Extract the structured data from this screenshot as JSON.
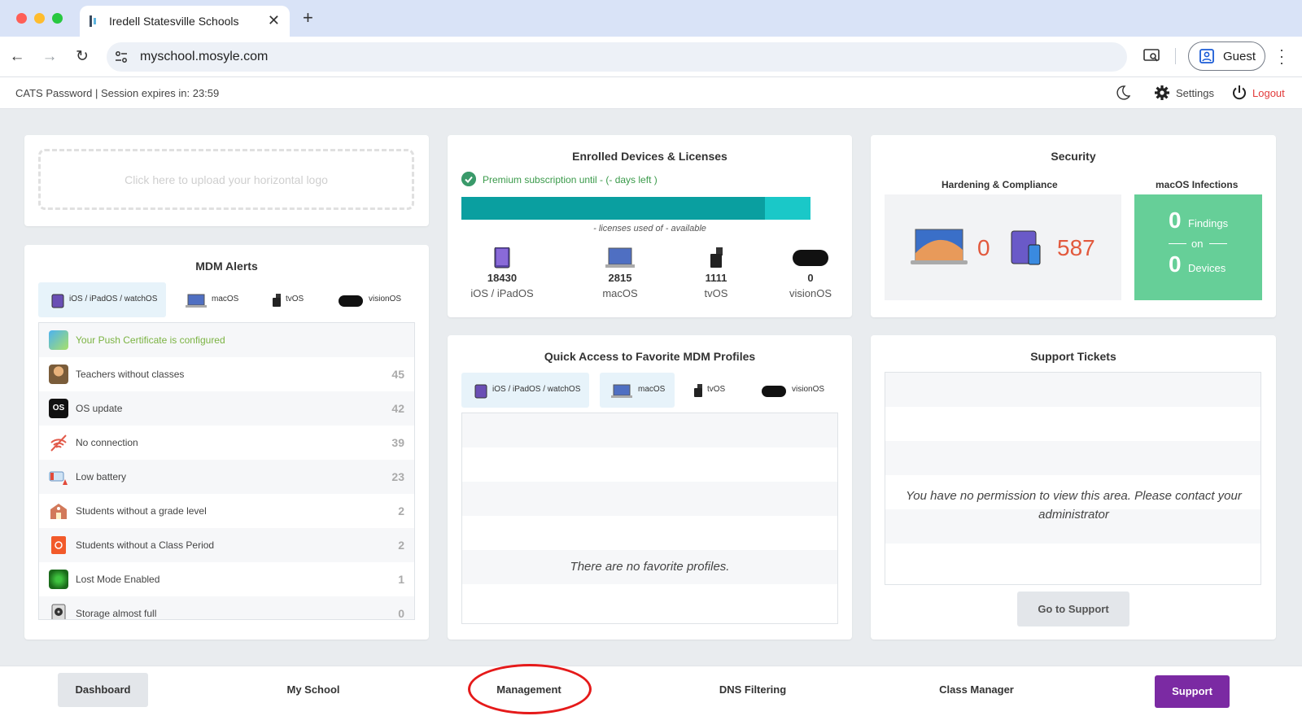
{
  "browser": {
    "tab_title": "Iredell Statesville Schools",
    "url": "myschool.mosyle.com",
    "profile_label": "Guest"
  },
  "header": {
    "session_text": "CATS Password | Session expires in: 23:59",
    "settings_label": "Settings",
    "logout_label": "Logout"
  },
  "logo_upload": {
    "text": "Click here to upload your horizontal logo"
  },
  "os_tabs": [
    {
      "label": "iOS / iPadOS / watchOS",
      "icon": "ipad-icon"
    },
    {
      "label": "macOS",
      "icon": "macbook-icon"
    },
    {
      "label": "tvOS",
      "icon": "apple-tv-icon"
    },
    {
      "label": "visionOS",
      "icon": "vision-pro-icon"
    }
  ],
  "mdm_alerts": {
    "title": "MDM Alerts",
    "items": [
      {
        "label": "Your Push Certificate is configured",
        "count": "",
        "icon": "push-certificate-icon"
      },
      {
        "label": "Teachers without classes",
        "count": "45",
        "icon": "teacher-icon"
      },
      {
        "label": "OS update",
        "count": "42",
        "icon": "os-update-icon"
      },
      {
        "label": "No connection",
        "count": "39",
        "icon": "no-connection-icon"
      },
      {
        "label": "Low battery",
        "count": "23",
        "icon": "low-battery-icon"
      },
      {
        "label": "Students without a grade level",
        "count": "2",
        "icon": "school-icon"
      },
      {
        "label": "Students without a Class Period",
        "count": "2",
        "icon": "class-period-icon"
      },
      {
        "label": "Lost Mode Enabled",
        "count": "1",
        "icon": "lost-mode-icon"
      },
      {
        "label": "Storage almost full",
        "count": "0",
        "icon": "storage-icon"
      }
    ]
  },
  "enrolled": {
    "title": "Enrolled Devices & Licenses",
    "premium_text": "Premium subscription until - (- days left )",
    "license_text": "- licenses used of - available",
    "license_used_fraction": 0.87,
    "devices": [
      {
        "count": "18430",
        "label": "iOS / iPadOS"
      },
      {
        "count": "2815",
        "label": "macOS"
      },
      {
        "count": "1111",
        "label": "tvOS"
      },
      {
        "count": "0",
        "label": "visionOS"
      }
    ]
  },
  "security": {
    "title": "Security",
    "hardening_title": "Hardening & Compliance",
    "infections_title": "macOS Infections",
    "mac_count": "0",
    "ios_count": "587",
    "findings_count": "0",
    "findings_label": "Findings",
    "on_label": "on",
    "devices_count": "0",
    "devices_label": "Devices"
  },
  "quick_access": {
    "title": "Quick Access to Favorite MDM Profiles",
    "empty_text": "There are no favorite profiles."
  },
  "support_tickets": {
    "title": "Support Tickets",
    "message": "You have no permission to view this area. Please contact your administrator",
    "button": "Go to Support"
  },
  "bottom_nav": {
    "items": [
      "Dashboard",
      "My School",
      "Management",
      "DNS Filtering",
      "Class Manager"
    ],
    "support": "Support"
  },
  "colors": {
    "accent_teal": "#0a9fa0",
    "security_green": "#66cf98",
    "alert_red": "#e2593d",
    "support_purple": "#7b2aa3",
    "annotation_red": "#e51a1a"
  }
}
